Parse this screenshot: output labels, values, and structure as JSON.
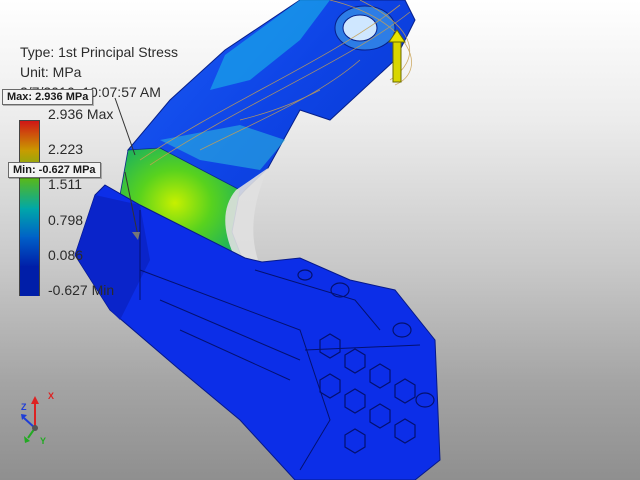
{
  "header": {
    "type_text": "Type: 1st Principal Stress",
    "unit_text": "Unit: MPa",
    "timestamp": "2/7/2016, 10:07:57 AM"
  },
  "legend": {
    "ticks": [
      "2.936 Max",
      "2.223",
      "1.511",
      "0.798",
      "0.086",
      "-0.627 Min"
    ],
    "colors": [
      "#d11616",
      "#c99b00",
      "#57b81c",
      "#00a8a8",
      "#0060c8",
      "#001ea8"
    ]
  },
  "probes": {
    "max_label": "Max: 2.936 MPa",
    "min_label": "Min: -0.627 MPa"
  },
  "triad": {
    "x_label": "X",
    "y_label": "Y",
    "z_label": "Z"
  }
}
